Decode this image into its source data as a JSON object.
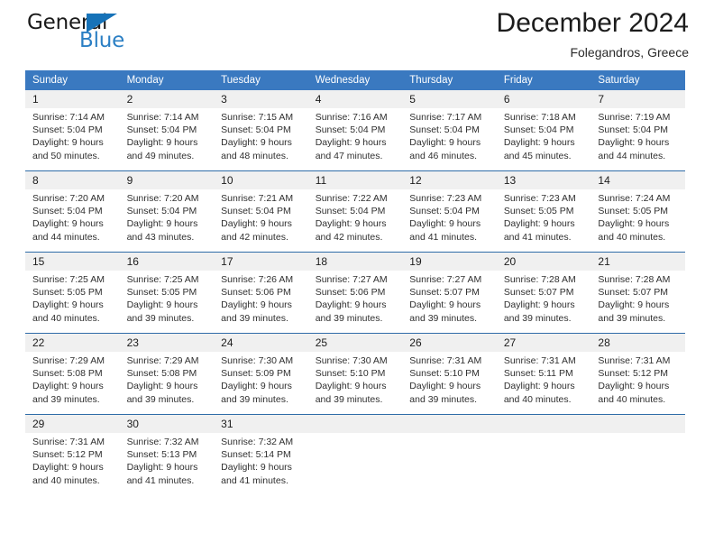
{
  "brand": {
    "name_part1": "General",
    "name_part2": "Blue",
    "triangle_icon": "triangle-icon",
    "accent_color": "#2b7fc4"
  },
  "header": {
    "title": "December 2024",
    "subtitle": "Folegandros, Greece"
  },
  "colors": {
    "header_blue": "#3a79c0",
    "week_divider": "#2f6ca8",
    "daynum_band": "#f0f0f0"
  },
  "weekdays": [
    "Sunday",
    "Monday",
    "Tuesday",
    "Wednesday",
    "Thursday",
    "Friday",
    "Saturday"
  ],
  "weeks": [
    {
      "days": [
        {
          "num": "1",
          "sunrise": "Sunrise: 7:14 AM",
          "sunset": "Sunset: 5:04 PM",
          "daylight1": "Daylight: 9 hours",
          "daylight2": "and 50 minutes."
        },
        {
          "num": "2",
          "sunrise": "Sunrise: 7:14 AM",
          "sunset": "Sunset: 5:04 PM",
          "daylight1": "Daylight: 9 hours",
          "daylight2": "and 49 minutes."
        },
        {
          "num": "3",
          "sunrise": "Sunrise: 7:15 AM",
          "sunset": "Sunset: 5:04 PM",
          "daylight1": "Daylight: 9 hours",
          "daylight2": "and 48 minutes."
        },
        {
          "num": "4",
          "sunrise": "Sunrise: 7:16 AM",
          "sunset": "Sunset: 5:04 PM",
          "daylight1": "Daylight: 9 hours",
          "daylight2": "and 47 minutes."
        },
        {
          "num": "5",
          "sunrise": "Sunrise: 7:17 AM",
          "sunset": "Sunset: 5:04 PM",
          "daylight1": "Daylight: 9 hours",
          "daylight2": "and 46 minutes."
        },
        {
          "num": "6",
          "sunrise": "Sunrise: 7:18 AM",
          "sunset": "Sunset: 5:04 PM",
          "daylight1": "Daylight: 9 hours",
          "daylight2": "and 45 minutes."
        },
        {
          "num": "7",
          "sunrise": "Sunrise: 7:19 AM",
          "sunset": "Sunset: 5:04 PM",
          "daylight1": "Daylight: 9 hours",
          "daylight2": "and 44 minutes."
        }
      ]
    },
    {
      "days": [
        {
          "num": "8",
          "sunrise": "Sunrise: 7:20 AM",
          "sunset": "Sunset: 5:04 PM",
          "daylight1": "Daylight: 9 hours",
          "daylight2": "and 44 minutes."
        },
        {
          "num": "9",
          "sunrise": "Sunrise: 7:20 AM",
          "sunset": "Sunset: 5:04 PM",
          "daylight1": "Daylight: 9 hours",
          "daylight2": "and 43 minutes."
        },
        {
          "num": "10",
          "sunrise": "Sunrise: 7:21 AM",
          "sunset": "Sunset: 5:04 PM",
          "daylight1": "Daylight: 9 hours",
          "daylight2": "and 42 minutes."
        },
        {
          "num": "11",
          "sunrise": "Sunrise: 7:22 AM",
          "sunset": "Sunset: 5:04 PM",
          "daylight1": "Daylight: 9 hours",
          "daylight2": "and 42 minutes."
        },
        {
          "num": "12",
          "sunrise": "Sunrise: 7:23 AM",
          "sunset": "Sunset: 5:04 PM",
          "daylight1": "Daylight: 9 hours",
          "daylight2": "and 41 minutes."
        },
        {
          "num": "13",
          "sunrise": "Sunrise: 7:23 AM",
          "sunset": "Sunset: 5:05 PM",
          "daylight1": "Daylight: 9 hours",
          "daylight2": "and 41 minutes."
        },
        {
          "num": "14",
          "sunrise": "Sunrise: 7:24 AM",
          "sunset": "Sunset: 5:05 PM",
          "daylight1": "Daylight: 9 hours",
          "daylight2": "and 40 minutes."
        }
      ]
    },
    {
      "days": [
        {
          "num": "15",
          "sunrise": "Sunrise: 7:25 AM",
          "sunset": "Sunset: 5:05 PM",
          "daylight1": "Daylight: 9 hours",
          "daylight2": "and 40 minutes."
        },
        {
          "num": "16",
          "sunrise": "Sunrise: 7:25 AM",
          "sunset": "Sunset: 5:05 PM",
          "daylight1": "Daylight: 9 hours",
          "daylight2": "and 39 minutes."
        },
        {
          "num": "17",
          "sunrise": "Sunrise: 7:26 AM",
          "sunset": "Sunset: 5:06 PM",
          "daylight1": "Daylight: 9 hours",
          "daylight2": "and 39 minutes."
        },
        {
          "num": "18",
          "sunrise": "Sunrise: 7:27 AM",
          "sunset": "Sunset: 5:06 PM",
          "daylight1": "Daylight: 9 hours",
          "daylight2": "and 39 minutes."
        },
        {
          "num": "19",
          "sunrise": "Sunrise: 7:27 AM",
          "sunset": "Sunset: 5:07 PM",
          "daylight1": "Daylight: 9 hours",
          "daylight2": "and 39 minutes."
        },
        {
          "num": "20",
          "sunrise": "Sunrise: 7:28 AM",
          "sunset": "Sunset: 5:07 PM",
          "daylight1": "Daylight: 9 hours",
          "daylight2": "and 39 minutes."
        },
        {
          "num": "21",
          "sunrise": "Sunrise: 7:28 AM",
          "sunset": "Sunset: 5:07 PM",
          "daylight1": "Daylight: 9 hours",
          "daylight2": "and 39 minutes."
        }
      ]
    },
    {
      "days": [
        {
          "num": "22",
          "sunrise": "Sunrise: 7:29 AM",
          "sunset": "Sunset: 5:08 PM",
          "daylight1": "Daylight: 9 hours",
          "daylight2": "and 39 minutes."
        },
        {
          "num": "23",
          "sunrise": "Sunrise: 7:29 AM",
          "sunset": "Sunset: 5:08 PM",
          "daylight1": "Daylight: 9 hours",
          "daylight2": "and 39 minutes."
        },
        {
          "num": "24",
          "sunrise": "Sunrise: 7:30 AM",
          "sunset": "Sunset: 5:09 PM",
          "daylight1": "Daylight: 9 hours",
          "daylight2": "and 39 minutes."
        },
        {
          "num": "25",
          "sunrise": "Sunrise: 7:30 AM",
          "sunset": "Sunset: 5:10 PM",
          "daylight1": "Daylight: 9 hours",
          "daylight2": "and 39 minutes."
        },
        {
          "num": "26",
          "sunrise": "Sunrise: 7:31 AM",
          "sunset": "Sunset: 5:10 PM",
          "daylight1": "Daylight: 9 hours",
          "daylight2": "and 39 minutes."
        },
        {
          "num": "27",
          "sunrise": "Sunrise: 7:31 AM",
          "sunset": "Sunset: 5:11 PM",
          "daylight1": "Daylight: 9 hours",
          "daylight2": "and 40 minutes."
        },
        {
          "num": "28",
          "sunrise": "Sunrise: 7:31 AM",
          "sunset": "Sunset: 5:12 PM",
          "daylight1": "Daylight: 9 hours",
          "daylight2": "and 40 minutes."
        }
      ]
    },
    {
      "days": [
        {
          "num": "29",
          "sunrise": "Sunrise: 7:31 AM",
          "sunset": "Sunset: 5:12 PM",
          "daylight1": "Daylight: 9 hours",
          "daylight2": "and 40 minutes."
        },
        {
          "num": "30",
          "sunrise": "Sunrise: 7:32 AM",
          "sunset": "Sunset: 5:13 PM",
          "daylight1": "Daylight: 9 hours",
          "daylight2": "and 41 minutes."
        },
        {
          "num": "31",
          "sunrise": "Sunrise: 7:32 AM",
          "sunset": "Sunset: 5:14 PM",
          "daylight1": "Daylight: 9 hours",
          "daylight2": "and 41 minutes."
        },
        {
          "num": "",
          "sunrise": "",
          "sunset": "",
          "daylight1": "",
          "daylight2": ""
        },
        {
          "num": "",
          "sunrise": "",
          "sunset": "",
          "daylight1": "",
          "daylight2": ""
        },
        {
          "num": "",
          "sunrise": "",
          "sunset": "",
          "daylight1": "",
          "daylight2": ""
        },
        {
          "num": "",
          "sunrise": "",
          "sunset": "",
          "daylight1": "",
          "daylight2": ""
        }
      ]
    }
  ]
}
